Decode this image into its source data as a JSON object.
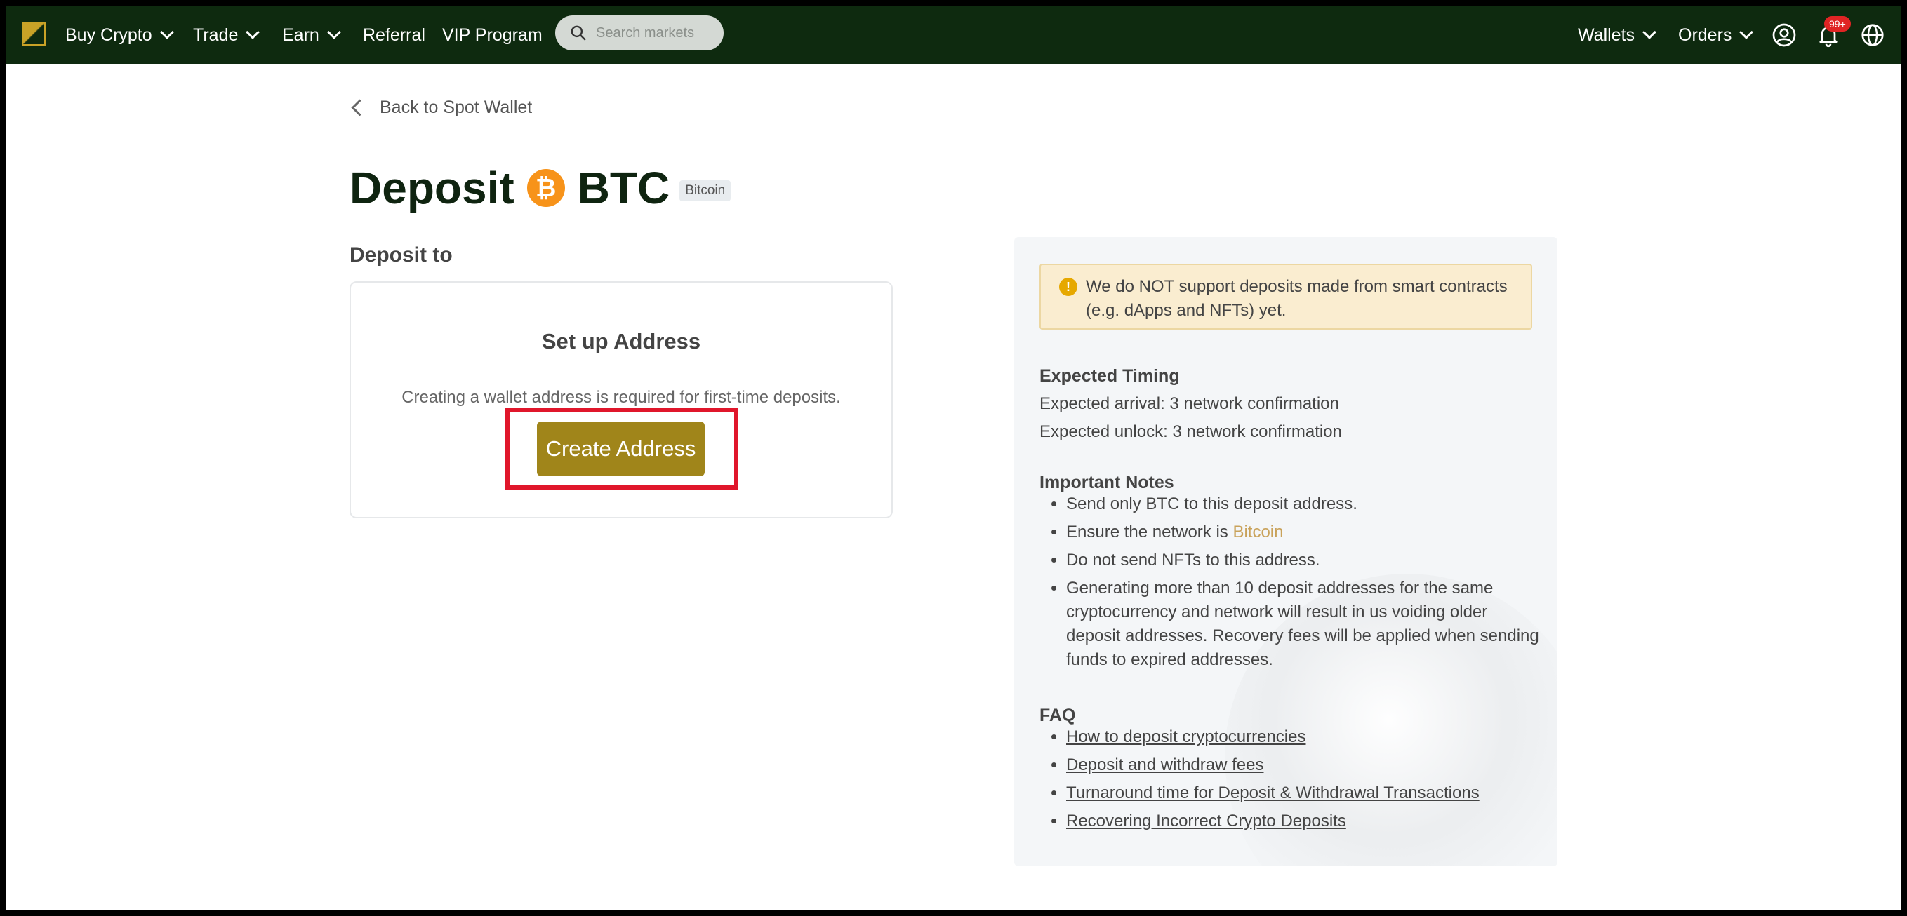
{
  "nav": {
    "items": [
      {
        "label": "Buy Crypto",
        "dropdown": true
      },
      {
        "label": "Trade",
        "dropdown": true
      },
      {
        "label": "Earn",
        "dropdown": true
      },
      {
        "label": "Referral",
        "dropdown": false
      },
      {
        "label": "VIP Program",
        "dropdown": false
      }
    ],
    "search_placeholder": "Search markets",
    "right": {
      "wallets": "Wallets",
      "orders": "Orders",
      "notifications_badge": "99+"
    }
  },
  "page": {
    "back_link": "Back to Spot Wallet",
    "title_prefix": "Deposit",
    "coin_symbol": "BTC",
    "coin_name": "Bitcoin",
    "deposit_to_label": "Deposit to"
  },
  "setup": {
    "heading": "Set up Address",
    "description": "Creating a wallet address is required for first-time deposits.",
    "button_label": "Create Address"
  },
  "info": {
    "warning": "We do NOT support deposits made from smart contracts (e.g. dApps and NFTs) yet.",
    "timing_title": "Expected Timing",
    "arrival": "Expected arrival: 3 network confirmation",
    "unlock": "Expected unlock: 3 network confirmation",
    "notes_title": "Important Notes",
    "notes": {
      "n1": "Send only BTC to this deposit address.",
      "n2_prefix": "Ensure the network is ",
      "n2_network": "Bitcoin",
      "n3": "Do not send NFTs to this address.",
      "n4": "Generating more than 10 deposit addresses for the same cryptocurrency and network will result in us voiding older deposit addresses. Recovery fees will be applied when sending funds to expired addresses."
    },
    "faq_title": "FAQ",
    "faq": [
      "How to deposit cryptocurrencies",
      "Deposit and withdraw fees",
      "Turnaround time for Deposit & Withdrawal Transactions",
      "Recovering Incorrect Crypto Deposits"
    ]
  },
  "colors": {
    "nav_bg": "#0e2a0f",
    "accent_gold": "#a0851a",
    "highlight_red": "#e0162b",
    "bitcoin_orange": "#f7931a"
  }
}
